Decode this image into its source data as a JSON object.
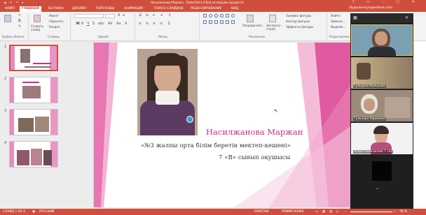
{
  "window": {
    "title": "Насилжанова Маржан - PowerPoint (Сбой активации продукта)"
  },
  "tabs": [
    {
      "label": "ФАЙЛ"
    },
    {
      "label": "ГЛАВНАЯ"
    },
    {
      "label": "ВСТАВКА"
    },
    {
      "label": "ДИЗАЙН"
    },
    {
      "label": "ПЕРЕХОДЫ"
    },
    {
      "label": "АНИМАЦИЯ"
    },
    {
      "label": "ПОКАЗ СЛАЙДОВ"
    },
    {
      "label": "РЕЦЕНЗИРОВАНИЕ"
    },
    {
      "label": "ВИД"
    }
  ],
  "account": "dlyapolovoiye@outlook.com",
  "ribbon": {
    "clipboard": {
      "group": "Буфер обмена"
    },
    "slides": {
      "new_slide": "Создать слайд",
      "layout": "Макет",
      "reset": "Сбросить",
      "section": "Раздел",
      "group": "Слайды"
    },
    "font": {
      "group": "Шрифт"
    },
    "paragraph": {
      "group": "Абзац"
    },
    "drawing": {
      "arrange": "Упорядочить",
      "quick_styles": "Экспресс-стили",
      "fill": "Заливка фигуры",
      "outline": "Контур фигуры",
      "effects": "Эффекты фигуры",
      "group": "Рисование"
    },
    "editing": {
      "find": "Найти",
      "replace": "Замени...",
      "select": "Выдели...",
      "group": "Редактирова..."
    }
  },
  "thumbnails": [
    {
      "number": "1",
      "selected": true
    },
    {
      "number": "2",
      "selected": false
    },
    {
      "number": "3",
      "selected": false
    },
    {
      "number": "4",
      "selected": false
    }
  ],
  "slide": {
    "name": "Насилжанова Маржан",
    "school": "«№3 жалпы орта білім беретін  мектеп-кешені»",
    "class": "7 «В» сынып  оқушысы"
  },
  "zoom": {
    "participants": [
      {
        "label": "",
        "speaking": true
      },
      {
        "label": "Гульдана Калыкова",
        "speaking": false
      },
      {
        "label": "Гульнара Каримова",
        "speaking": false
      },
      {
        "label": "Анара Рамазанова 7 «А»",
        "speaking": false
      },
      {
        "label": "",
        "speaking": false
      }
    ]
  },
  "status": {
    "slide_info": "СЛАЙД 1 ИЗ 4",
    "language": "РУССКИЙ",
    "notes": "ЗАМЕТКИ",
    "comments": "ПРИМЕЧАНИЯ",
    "zoom": "78 %"
  },
  "colors": {
    "accent": "#d04f3c",
    "slide_pink": "#e05aa0",
    "name_color": "#c4327f"
  }
}
